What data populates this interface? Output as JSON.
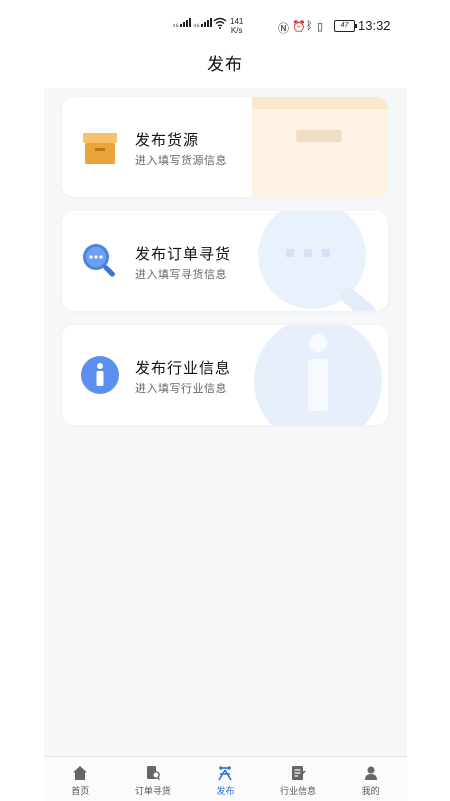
{
  "status_bar": {
    "signal1": "⁴⁶",
    "signal2": "⁴⁶",
    "speed_value": "141",
    "speed_unit": "K/s",
    "battery": "47",
    "time": "13:32"
  },
  "header": {
    "title": "发布"
  },
  "cards": [
    {
      "title": "发布货源",
      "subtitle": "进入填写货源信息",
      "icon": "box-icon"
    },
    {
      "title": "发布订单寻货",
      "subtitle": "进入填写寻货信息",
      "icon": "search-chat-icon"
    },
    {
      "title": "发布行业信息",
      "subtitle": "进入填写行业信息",
      "icon": "info-icon"
    }
  ],
  "tabs": [
    {
      "label": "首页",
      "icon": "home-icon"
    },
    {
      "label": "订单寻货",
      "icon": "order-search-icon"
    },
    {
      "label": "发布",
      "icon": "publish-icon",
      "active": true
    },
    {
      "label": "行业信息",
      "icon": "news-icon"
    },
    {
      "label": "我的",
      "icon": "user-icon"
    }
  ],
  "colors": {
    "accent": "#2f6fe0",
    "box": "#e9a43c",
    "search": "#4a86e8",
    "info": "#5b8ff0"
  }
}
